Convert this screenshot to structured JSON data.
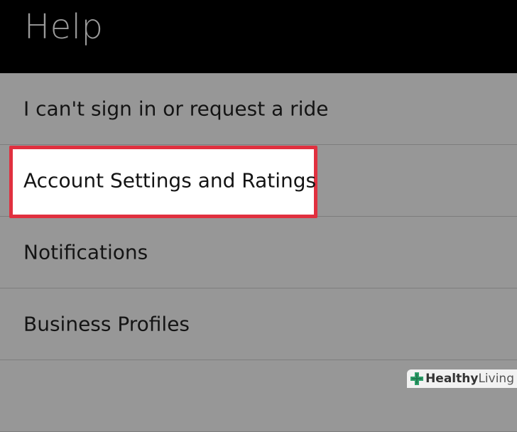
{
  "header": {
    "title": "Help"
  },
  "menu": {
    "items": [
      {
        "label": "I can't sign in or request a ride"
      },
      {
        "label": "Account Settings and Ratings",
        "highlighted": true
      },
      {
        "label": "Notifications"
      },
      {
        "label": "Business Profiles"
      },
      {
        "label": ""
      }
    ]
  },
  "watermark": {
    "brand_bold": "Healthy",
    "brand_light": "Living"
  },
  "colors": {
    "header_bg": "#000000",
    "list_bg": "#979797",
    "highlight_border": "#e0303f",
    "highlight_fill": "#ffffff",
    "logo_accent": "#2e9e6a"
  },
  "icons": {
    "watermark_logo": "medical-cross-icon"
  }
}
